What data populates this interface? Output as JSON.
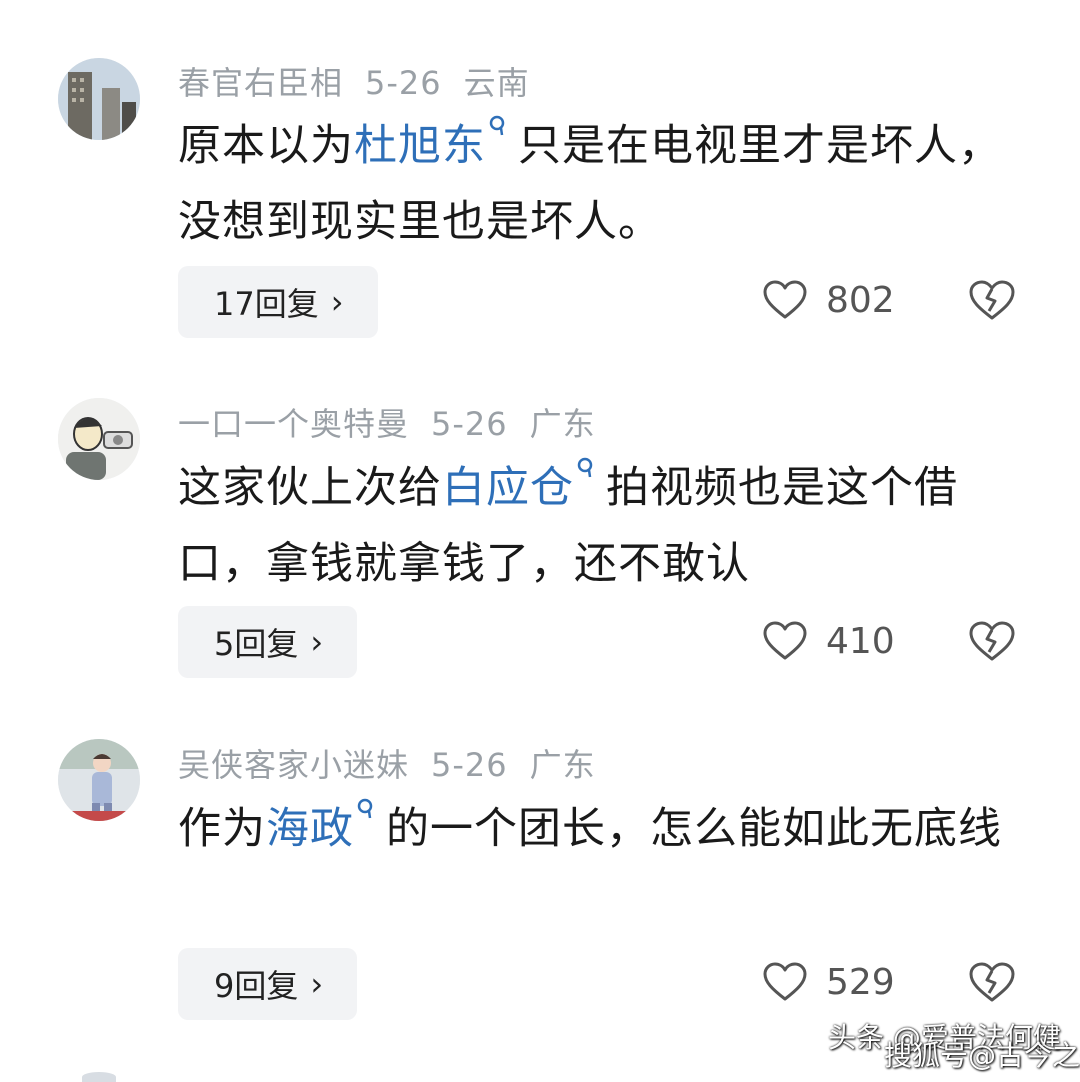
{
  "comments": [
    {
      "user": "春官右臣相",
      "date": "5-26",
      "location": "云南",
      "text_before": "原本以为",
      "topic": "杜旭东",
      "text_after": "只是在电视里才是坏人，没想到现实里也是坏人。",
      "reply_label": "17回复",
      "likes": "802",
      "avatar_icon": "building-photo-avatar"
    },
    {
      "user": "一口一个奥特曼",
      "date": "5-26",
      "location": "广东",
      "text_before": "这家伙上次给",
      "topic": "白应仓",
      "text_after": "拍视频也是这个借口，拿钱就拿钱了，还不敢认",
      "reply_label": "5回复",
      "likes": "410",
      "avatar_icon": "cartoon-avatar"
    },
    {
      "user": "吴侠客家小迷妹",
      "date": "5-26",
      "location": "广东",
      "text_before": "作为",
      "topic": "海政",
      "text_after": "的一个团长，怎么能如此无底线",
      "reply_label": "9回复",
      "likes": "529",
      "avatar_icon": "child-photo-avatar"
    }
  ],
  "watermark": {
    "line1": "头条 @爱普法何健",
    "line2": "搜狐号@古今之鉴"
  },
  "colors": {
    "topic": "#2e6fb8",
    "meta": "#9aa0a6",
    "reply_bg": "#f2f3f5"
  }
}
